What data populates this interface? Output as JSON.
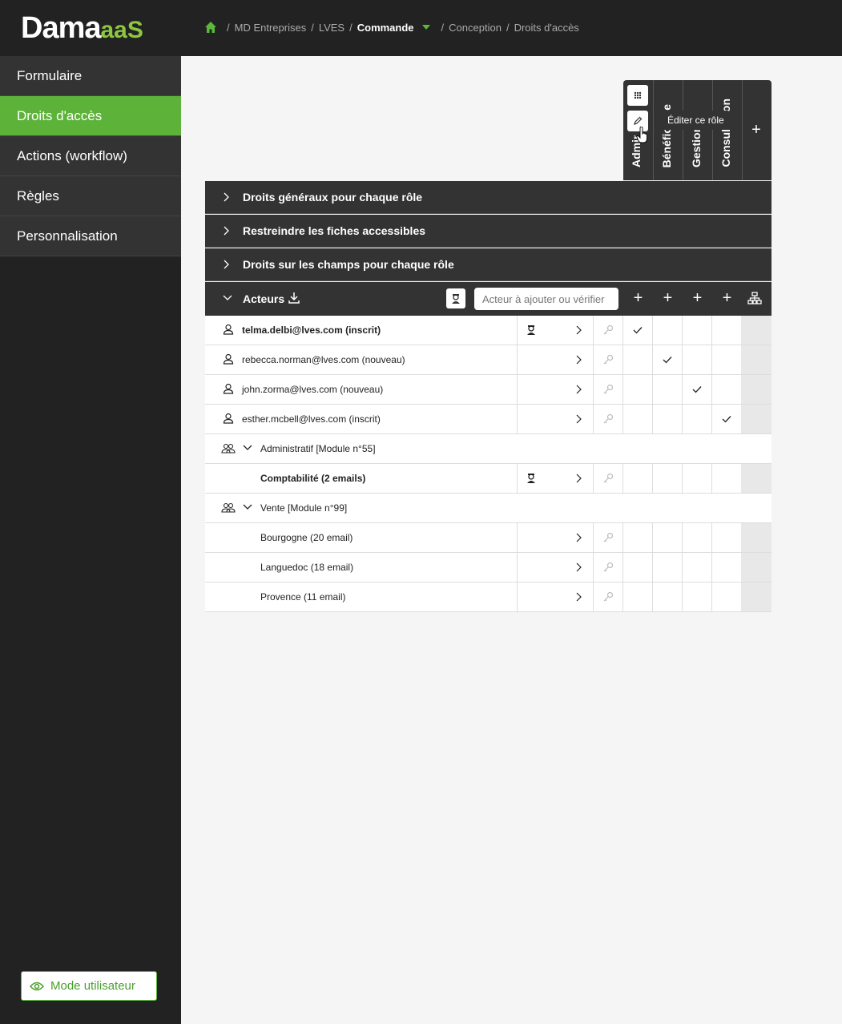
{
  "app": {
    "logo_main": "Dama",
    "logo_accent": "aaS"
  },
  "breadcrumb": {
    "items": [
      "MD Entreprises",
      "LVES"
    ],
    "current": "Commande",
    "after": [
      "Conception",
      "Droits d'accès"
    ]
  },
  "sidebar": {
    "items": [
      {
        "label": "Formulaire"
      },
      {
        "label": "Droits d'accès"
      },
      {
        "label": "Actions (workflow)"
      },
      {
        "label": "Règles"
      },
      {
        "label": "Personnalisation"
      }
    ],
    "mode_button": "Mode utilisateur"
  },
  "roles": {
    "columns": [
      "Administrateur",
      "Bénéficiaire",
      "Gestionnaire",
      "Consultation"
    ],
    "tooltip": "Éditer ce rôle",
    "add_label": "+"
  },
  "sections": {
    "general": "Droits généraux pour chaque rôle",
    "restrict": "Restreindre les fiches accessibles",
    "fields": "Droits sur les champs pour chaque rôle"
  },
  "acteurs": {
    "title": "Acteurs",
    "search_placeholder": "Acteur à ajouter ou vérifier",
    "plus": "+"
  },
  "rows": [
    {
      "name": "telma.delbi@lves.com (inscrit)",
      "bold": true,
      "badge": true,
      "checks": [
        true,
        false,
        false,
        false
      ]
    },
    {
      "name": "rebecca.norman@lves.com (nouveau)",
      "bold": false,
      "badge": false,
      "checks": [
        false,
        true,
        false,
        false
      ]
    },
    {
      "name": "john.zorma@lves.com (nouveau)",
      "bold": false,
      "badge": false,
      "checks": [
        false,
        false,
        true,
        false
      ]
    },
    {
      "name": "esther.mcbell@lves.com (inscrit)",
      "bold": false,
      "badge": false,
      "checks": [
        false,
        false,
        false,
        true
      ]
    }
  ],
  "groups": [
    {
      "name": "Administratif [Module n°55]",
      "children": [
        {
          "name": "Comptabilité (2 emails)",
          "bold": true,
          "badge": true
        }
      ]
    },
    {
      "name": "Vente [Module n°99]",
      "children": [
        {
          "name": "Bourgogne (20 email)",
          "bold": false,
          "badge": false
        },
        {
          "name": "Languedoc (18 email)",
          "bold": false,
          "badge": false
        },
        {
          "name": "Provence (11 email)",
          "bold": false,
          "badge": false
        }
      ]
    }
  ],
  "colors": {
    "accent": "#5db33a",
    "dark": "#222222",
    "panel": "#333333"
  }
}
